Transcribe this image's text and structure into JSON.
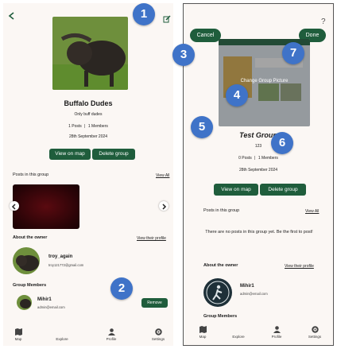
{
  "left": {
    "group_name": "Buffalo Dudes",
    "description": "Only buff dudes",
    "posts_count": "1 Posts",
    "members_count": "1 Members",
    "created_date": "28th September 2024",
    "view_on_map": "View on map",
    "delete_group": "Delete group",
    "posts_title": "Posts in this group",
    "view_all": "View All",
    "about_owner": "About the owner",
    "view_profile": "View their profile",
    "owner_name": "troy_again",
    "owner_email": "troy121772@gmail.com",
    "members_title": "Group Members",
    "member_name": "Mihir1",
    "member_email": "admin@email.com",
    "remove": "Remove"
  },
  "right": {
    "cancel": "Cancel",
    "done": "Done",
    "help": "?",
    "change_picture": "Change Group Picture",
    "group_name": "Test Group",
    "description": "123",
    "posts_count": "0 Posts",
    "members_count": "1 Members",
    "created_date": "28th September 2024",
    "view_on_map": "View on map",
    "delete_group": "Delete group",
    "posts_title": "Posts in this group",
    "view_all": "View All",
    "empty_posts": "There are no posts in this group yet. Be the first to post!",
    "about_owner": "About the owner",
    "view_profile": "View their profile",
    "owner_name": "Mihir1",
    "owner_email": "admin@email.com",
    "members_title": "Group Members"
  },
  "nav": {
    "map": "Map",
    "explore": "Explore",
    "profile": "Profile",
    "settings": "Settings"
  },
  "callouts": [
    "1",
    "2",
    "3",
    "4",
    "5",
    "6",
    "7"
  ],
  "colors": {
    "accent": "#1f5d3c",
    "callout": "#3f73c8",
    "background": "#fbf7f4"
  }
}
